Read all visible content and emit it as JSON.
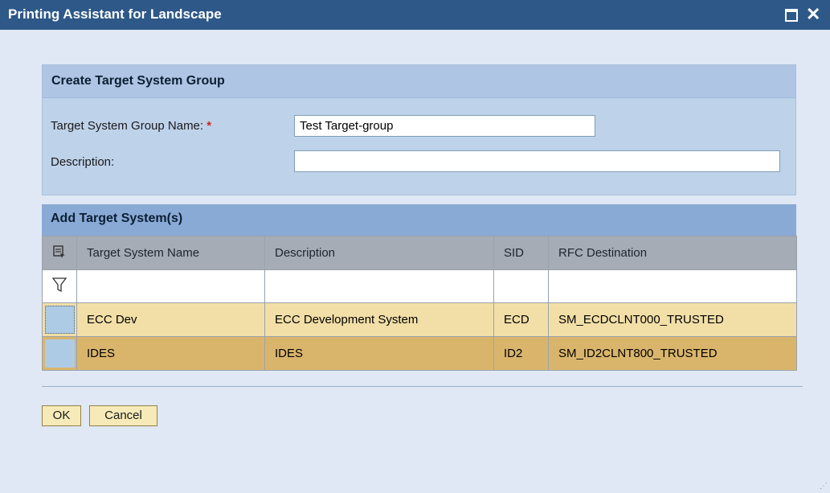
{
  "window": {
    "title": "Printing Assistant for Landscape",
    "maximize_icon": "maximize-icon",
    "close_icon": "close-icon",
    "close_glyph": "✕"
  },
  "create_group": {
    "heading": "Create Target System Group",
    "name_label": "Target System Group Name:",
    "required_mark": "*",
    "name_value": "Test Target-group",
    "description_label": "Description:",
    "description_value": ""
  },
  "add_systems": {
    "heading": "Add Target System(s)",
    "select_all_icon": "select-all-icon",
    "filter_icon": "filter-icon",
    "columns": [
      "Target System Name",
      "Description",
      "SID",
      "RFC Destination"
    ],
    "rows": [
      {
        "name": "ECC Dev",
        "description": "ECC Development System",
        "sid": "ECD",
        "rfc": "SM_ECDCLNT000_TRUSTED"
      },
      {
        "name": "IDES",
        "description": "IDES",
        "sid": "ID2",
        "rfc": "SM_ID2CLNT800_TRUSTED"
      }
    ]
  },
  "buttons": {
    "ok": "OK",
    "cancel": "Cancel"
  },
  "colors": {
    "titlebar": "#2d5888",
    "panel": "#dfe8f4",
    "row_highlight": "#f2dfa7",
    "row_selected": "#d9b56c",
    "button": "#f6eab8"
  }
}
